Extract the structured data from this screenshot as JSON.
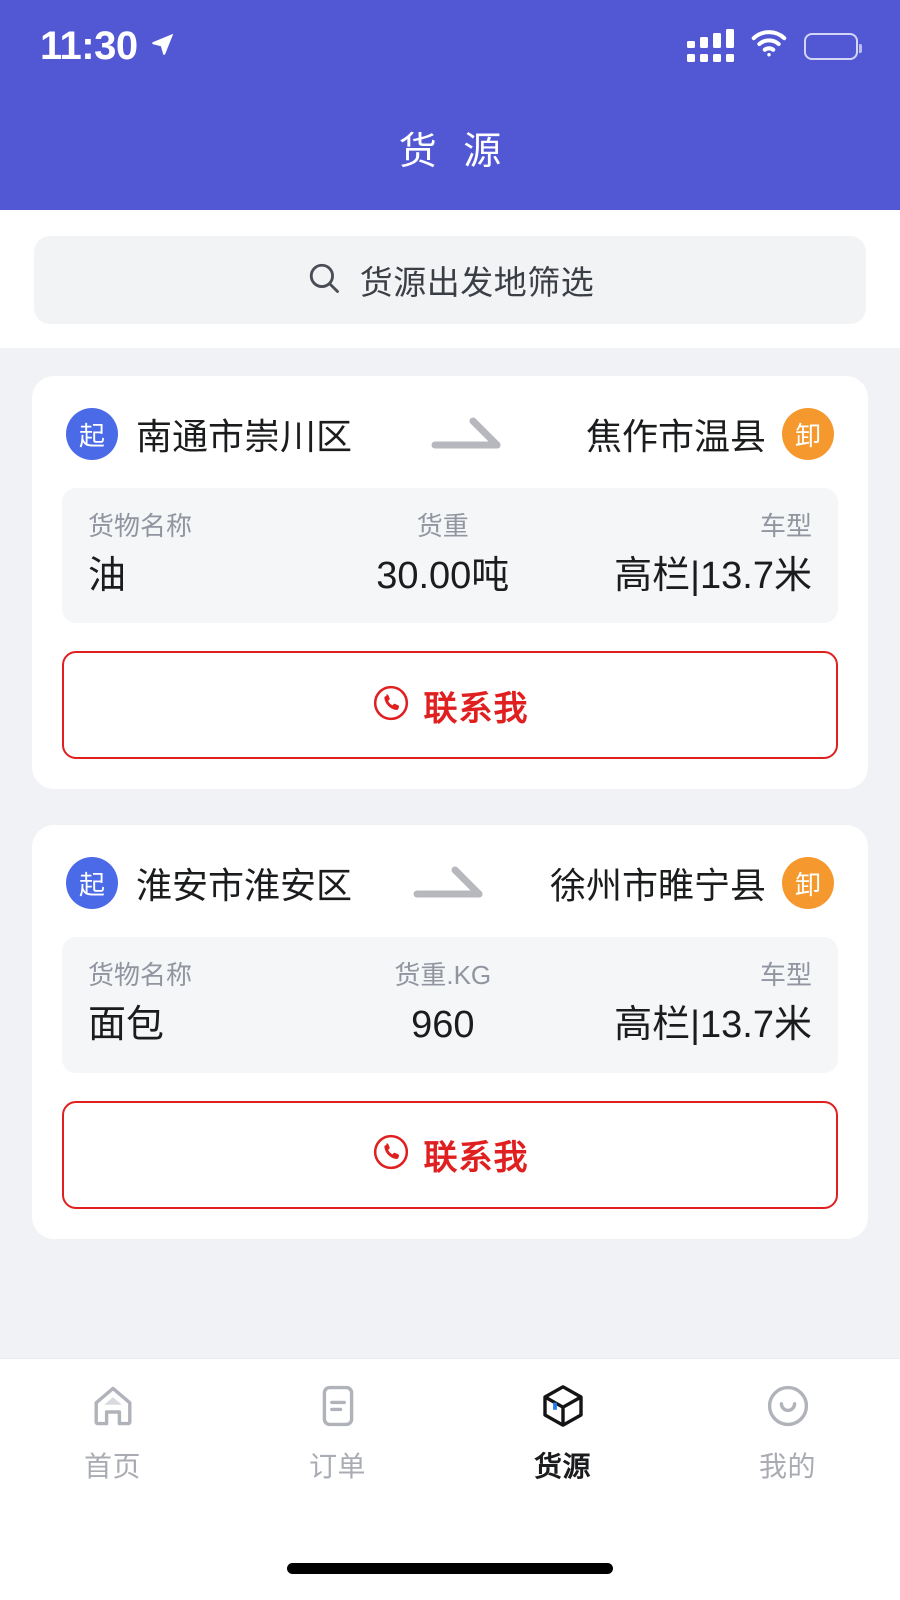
{
  "status_bar": {
    "time": "11:30",
    "location_icon": "location-arrow-icon",
    "signal_icon": "cellular-signal-icon",
    "wifi_icon": "wifi-icon",
    "battery_icon": "battery-icon"
  },
  "header": {
    "title": "货 源",
    "background_color": "#5258d4"
  },
  "search": {
    "icon": "search-icon",
    "placeholder": "货源出发地筛选",
    "value": ""
  },
  "colors": {
    "accent_purple": "#5258d4",
    "origin_badge": "#4a6ae8",
    "dest_badge": "#f5992f",
    "contact_red": "#e02020",
    "page_background": "#f1f2f6",
    "info_panel": "#f5f6f8"
  },
  "cards": [
    {
      "origin_badge": "起",
      "origin_city": "南通市崇川区",
      "arrow_icon": "route-arrow-icon",
      "dest_city": "焦作市温县",
      "dest_badge": "卸",
      "info": [
        {
          "label": "货物名称",
          "value": "油"
        },
        {
          "label": "货重",
          "value": "30.00吨"
        },
        {
          "label": "车型",
          "value": "高栏|13.7米"
        }
      ],
      "contact": {
        "icon": "phone-icon",
        "label": "联系我"
      }
    },
    {
      "origin_badge": "起",
      "origin_city": "淮安市淮安区",
      "arrow_icon": "route-arrow-icon",
      "dest_city": "徐州市睢宁县",
      "dest_badge": "卸",
      "info": [
        {
          "label": "货物名称",
          "value": "面包"
        },
        {
          "label": "货重.KG",
          "value": "960"
        },
        {
          "label": "车型",
          "value": "高栏|13.7米"
        }
      ],
      "contact": {
        "icon": "phone-icon",
        "label": "联系我"
      }
    }
  ],
  "tabbar": {
    "items": [
      {
        "label": "首页",
        "icon": "home-icon",
        "active": false
      },
      {
        "label": "订单",
        "icon": "order-list-icon",
        "active": false
      },
      {
        "label": "货源",
        "icon": "box-cube-icon",
        "active": true
      },
      {
        "label": "我的",
        "icon": "smiley-face-icon",
        "active": false
      }
    ]
  }
}
